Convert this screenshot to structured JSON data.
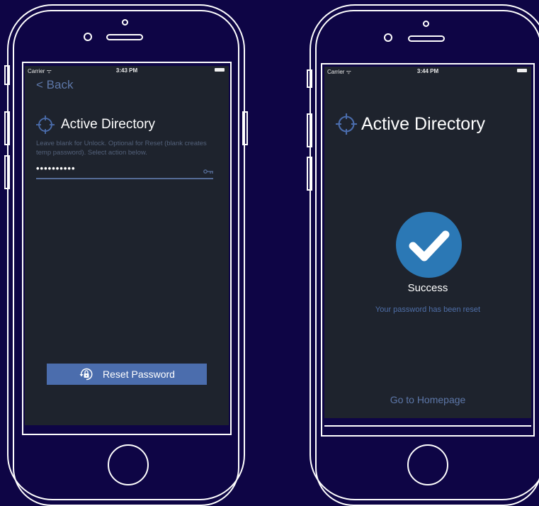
{
  "left_phone": {
    "status_bar": {
      "carrier": "Carrier ᯤ",
      "time": "3:43 PM"
    },
    "back_label": "< Back",
    "brand_title": "Active Directory",
    "hint": "Leave blank for Unlock. Optional for Reset (blank creates temp password). Select action below.",
    "password_value": "••••••••••",
    "reset_button_label": "Reset Password"
  },
  "right_phone": {
    "status_bar": {
      "carrier": "Carrier ᯤ",
      "time": "3:44 PM"
    },
    "brand_title": "Active Directory",
    "success_title": "Success",
    "success_message": "Your password has been reset",
    "home_link": "Go to Homepage"
  },
  "icons": [
    "crosshair-logo-icon",
    "key-icon",
    "reset-lock-icon",
    "checkmark-icon",
    "wifi-icon",
    "battery-icon"
  ],
  "colors": {
    "background": "#0e0545",
    "screen": "#1e232d",
    "accent": "#4b6dad",
    "success_circle": "#2b78b5",
    "link": "#5d77a8",
    "hint_text": "#53617a"
  }
}
